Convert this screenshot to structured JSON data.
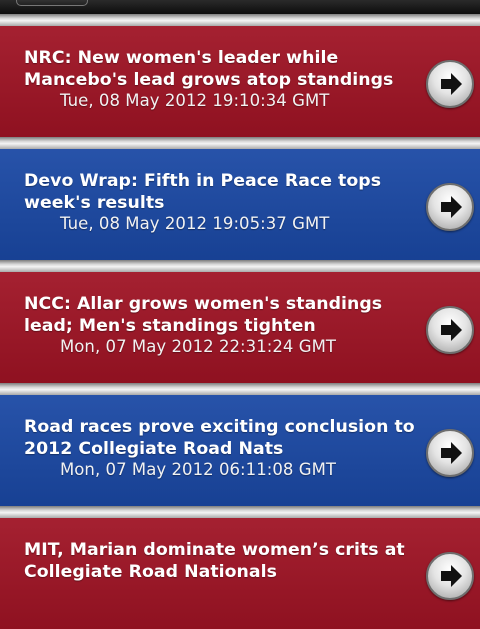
{
  "articles": [
    {
      "title": "NRC: New women's leader while Mancebo's lead grows atop standings",
      "date": "Tue, 08 May 2012 19:10:34 GMT",
      "color": "#9f1324"
    },
    {
      "title": "Devo Wrap: Fifth in Peace Race tops week's results",
      "date": "Tue, 08 May 2012 19:05:37 GMT",
      "color": "#1a48a4"
    },
    {
      "title": "NCC: Allar grows women's standings lead; Men's standings tighten",
      "date": "Mon, 07 May 2012 22:31:24 GMT",
      "color": "#9f1324"
    },
    {
      "title": "Road races prove exciting conclusion to 2012 Collegiate Road Nats",
      "date": "Mon, 07 May 2012 06:11:08 GMT",
      "color": "#1a48a4"
    },
    {
      "title": "MIT, Marian dominate women’s crits at Collegiate Road Nationals",
      "date": "",
      "color": "#9f1324"
    }
  ],
  "icons": {
    "arrow": "right-arrow-icon",
    "back": "back-button"
  }
}
